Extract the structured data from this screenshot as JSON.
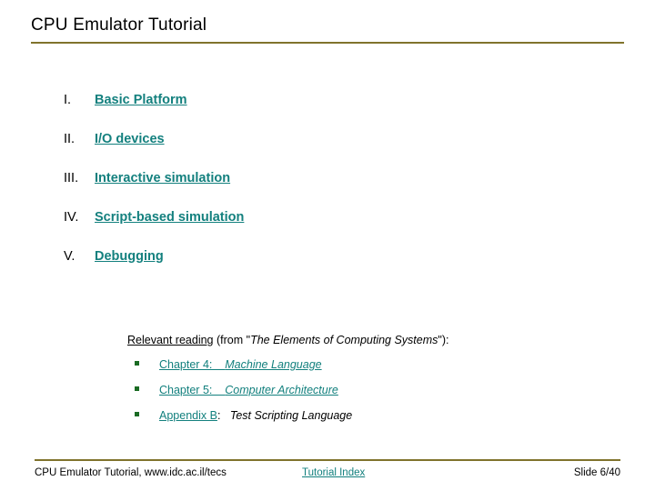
{
  "slide": {
    "title": "CPU Emulator Tutorial",
    "accent_rule_color": "#80732c",
    "link_color": "#13807e",
    "bullet_color": "#1a6b23",
    "background": "#ffffff"
  },
  "outline": {
    "items": [
      {
        "numeral": "I.",
        "label": "Basic Platform"
      },
      {
        "numeral": "II.",
        "label": "I/O devices"
      },
      {
        "numeral": "III.",
        "label": "Interactive simulation"
      },
      {
        "numeral": "IV.",
        "label": "Script-based simulation"
      },
      {
        "numeral": "V.",
        "label": "Debugging"
      }
    ]
  },
  "reading": {
    "heading_link": "Relevant reading",
    "heading_prefix": " (from \"",
    "heading_book": "The Elements of Computing Systems",
    "heading_suffix": "\"):",
    "entries": [
      {
        "bullet": "square-bullet",
        "link_label": "Chapter 4:",
        "link_title": "Machine Language",
        "link_title_in_link": true,
        "plain_colon": "",
        "plain_title": ""
      },
      {
        "bullet": "square-bullet",
        "link_label": "Chapter 5:",
        "link_title": "Computer Architecture",
        "link_title_in_link": true,
        "plain_colon": "",
        "plain_title": ""
      },
      {
        "bullet": "square-bullet",
        "link_label": "Appendix B",
        "link_title": "",
        "link_title_in_link": false,
        "plain_colon": ":   ",
        "plain_title": "Test Scripting Language"
      }
    ]
  },
  "footer": {
    "left": "CPU Emulator Tutorial, www.idc.ac.il/tecs",
    "center_link": "Tutorial Index",
    "right": "Slide 6/40"
  }
}
